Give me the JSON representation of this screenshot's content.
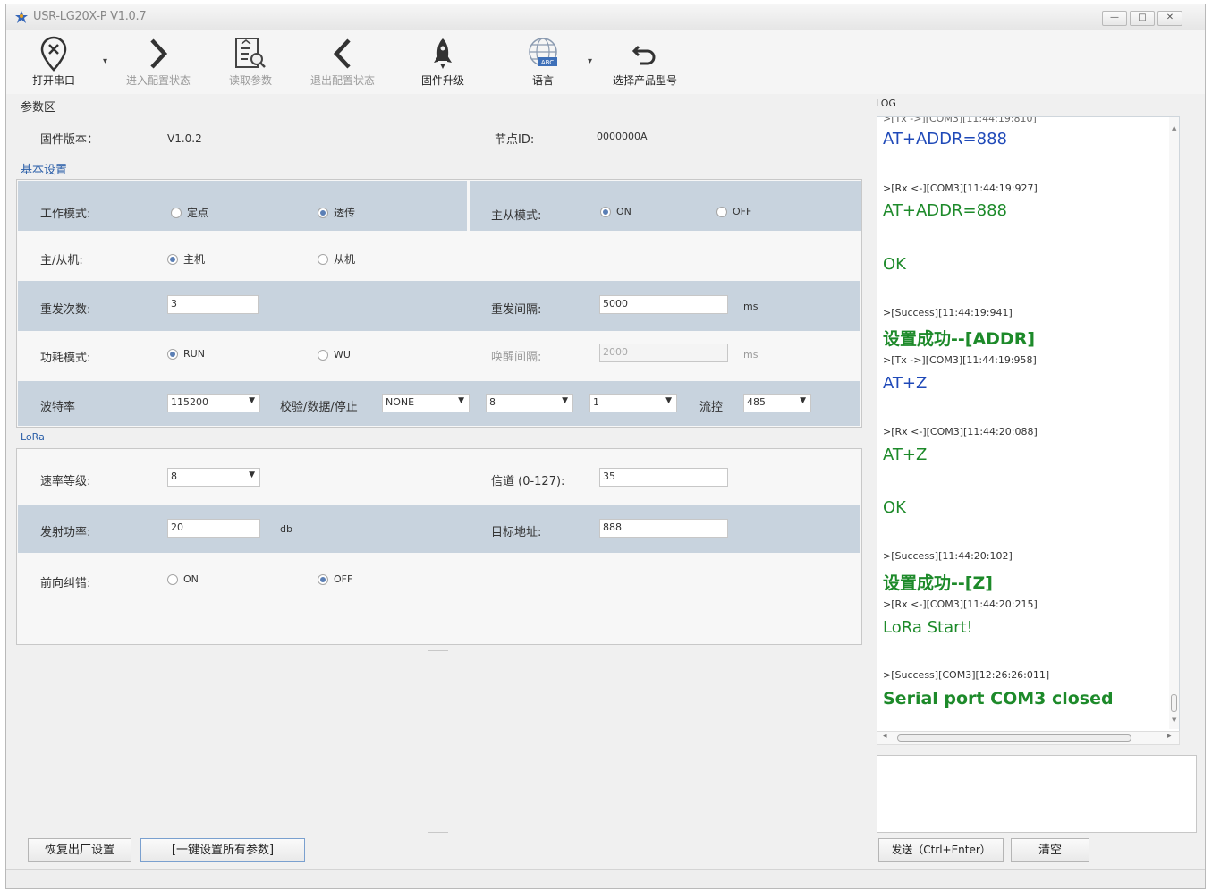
{
  "window": {
    "title": "USR-LG20X-P  V1.0.7",
    "min": "—",
    "max": "□",
    "close": "✕"
  },
  "toolbar": {
    "open_port": "打开串口",
    "enter_config": "进入配置状态",
    "read_params": "读取参数",
    "exit_config": "退出配置状态",
    "firmware_upgrade": "固件升级",
    "language": "语言",
    "select_model": "选择产品型号",
    "lang_badge": "ABC"
  },
  "params": {
    "section_title": "参数区",
    "firmware_label": "固件版本：",
    "firmware_value": "V1.0.2",
    "node_id_label": "节点ID:",
    "node_id_value": "0000000A"
  },
  "basic": {
    "title": "基本设置",
    "work_mode_label": "工作模式:",
    "work_mode_opt1": "定点",
    "work_mode_opt2": "透传",
    "master_mode_label": "主从模式:",
    "master_mode_on": "ON",
    "master_mode_off": "OFF",
    "role_label": "主/从机:",
    "role_master": "主机",
    "role_slave": "从机",
    "retry_count_label": "重发次数:",
    "retry_count_value": "3",
    "retry_interval_label": "重发间隔:",
    "retry_interval_value": "5000",
    "retry_interval_unit": "ms",
    "power_mode_label": "功耗模式:",
    "power_run": "RUN",
    "power_wu": "WU",
    "wake_interval_label": "唤醒间隔:",
    "wake_interval_value": "2000",
    "wake_interval_unit": "ms",
    "baud_label": "波特率",
    "baud_value": "115200",
    "parity_label": "校验/数据/停止",
    "parity_value": "NONE",
    "data_bits_value": "8",
    "stop_bits_value": "1",
    "flow_label": "流控",
    "flow_value": "485"
  },
  "lora": {
    "title": "LoRa",
    "rate_label": "速率等级:",
    "rate_value": "8",
    "channel_label": "信道 (0-127):",
    "channel_value": "35",
    "tx_power_label": "发射功率:",
    "tx_power_value": "20",
    "tx_power_unit": "db",
    "target_addr_label": "目标地址:",
    "target_addr_value": "888",
    "fec_label": "前向纠错:",
    "fec_on": "ON",
    "fec_off": "OFF"
  },
  "bottom": {
    "restore": "恢复出厂设置",
    "set_all": "[一键设置所有参数]"
  },
  "log": {
    "title": "LOG",
    "entries": [
      {
        "head": "",
        "text": "AT+ADDR=888",
        "style": "blue"
      },
      {
        "head": ">[Rx <-][COM3][11:44:19:927]",
        "text": "AT+ADDR=888",
        "style": "green"
      },
      {
        "head": "",
        "text": "OK",
        "style": "green"
      },
      {
        "head": ">[Success][11:44:19:941]",
        "text": "设置成功--[ADDR]",
        "style": "boldg"
      },
      {
        "head": ">[Tx ->][COM3][11:44:19:958]",
        "text": "AT+Z",
        "style": "blue"
      },
      {
        "head": ">[Rx <-][COM3][11:44:20:088]",
        "text": "AT+Z",
        "style": "green"
      },
      {
        "head": "",
        "text": "OK",
        "style": "green"
      },
      {
        "head": ">[Success][11:44:20:102]",
        "text": "设置成功--[Z]",
        "style": "boldg"
      },
      {
        "head": ">[Rx <-][COM3][11:44:20:215]",
        "text": "LoRa Start!",
        "style": "green"
      },
      {
        "head": ">[Success][COM3][12:26:26:011]",
        "text": "Serial port COM3 closed",
        "style": "boldg"
      }
    ],
    "send_button": "发送（Ctrl+Enter）",
    "clear_button": "清空"
  },
  "colors": {
    "accent": "#2a5ea8",
    "band": "#c8d3de",
    "log_blue": "#1f49b8",
    "log_green": "#1d8a2a"
  }
}
